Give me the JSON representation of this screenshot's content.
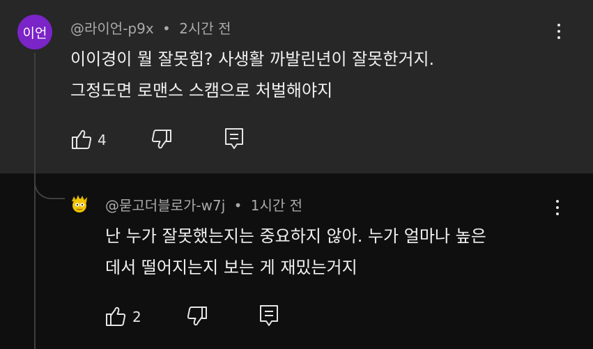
{
  "comment": {
    "avatar_text": "이언",
    "author": "@라이언-p9x",
    "separator": "•",
    "time": "2시간 전",
    "lines": [
      "이이경이 뭘 잘못힘? 사생활 까발린년이 잘못한거지.",
      "그정도면 로맨스 스캠으로 처벌해야지"
    ],
    "like_count": "4"
  },
  "reply": {
    "author": "@묻고더블로가-w7j",
    "separator": "•",
    "time": "1시간 전",
    "lines": [
      "난 누가 잘못했는지는 중요하지 않아. 누가 얼마나 높은",
      "데서 떨어지는지 보는 게 재밌는거지"
    ],
    "like_count": "2"
  },
  "icons": {
    "like": "thumbs-up-icon",
    "dislike": "thumbs-down-icon",
    "reply": "reply-comment-icon",
    "more": "more-vertical-icon"
  },
  "colors": {
    "comment_bg": "#272727",
    "reply_bg": "#0f0f0f",
    "avatar_bg": "#7b24c7",
    "meta_text": "#aaaaaa",
    "body_text": "#f1f1f1"
  }
}
